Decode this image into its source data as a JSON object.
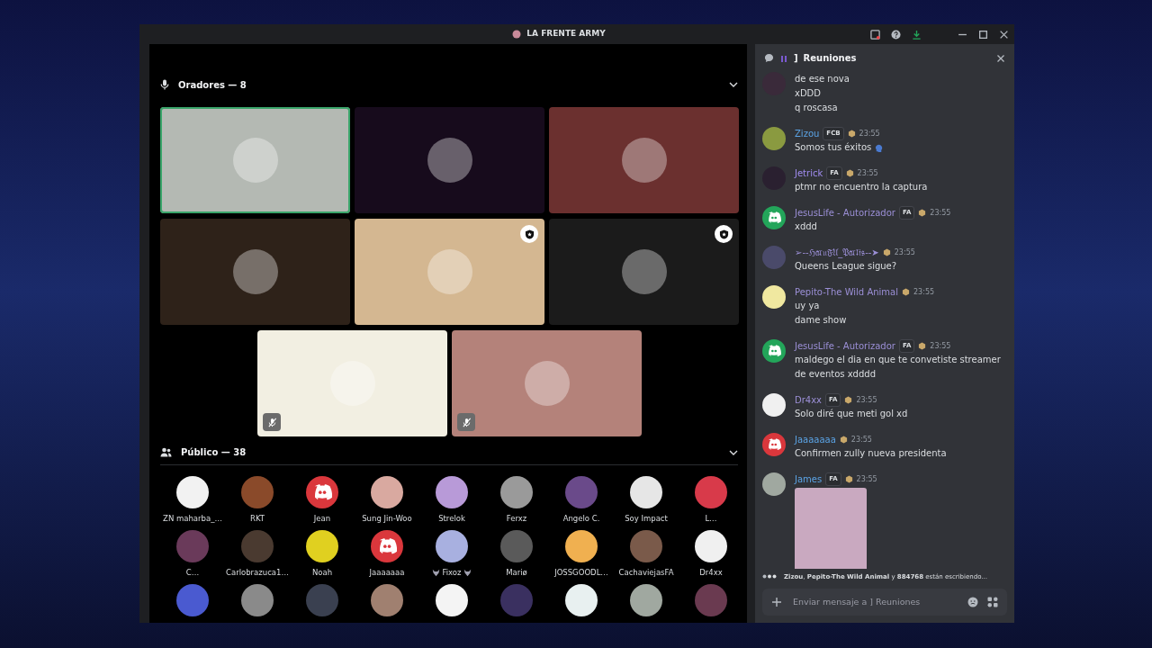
{
  "window": {
    "title": "LA FRENTE ARMY"
  },
  "stage": {
    "speakers_header": "Oradores — 8",
    "speakers": [
      {
        "color": "#b4b9b3",
        "speaking": true,
        "moderator": false,
        "muted": false
      },
      {
        "color": "#170b1c",
        "speaking": false,
        "moderator": false,
        "muted": false
      },
      {
        "color": "#6b302f",
        "speaking": false,
        "moderator": false,
        "muted": false
      },
      {
        "color": "#2e2219",
        "speaking": false,
        "moderator": false,
        "muted": false
      },
      {
        "color": "#d4b791",
        "speaking": false,
        "moderator": true,
        "muted": false
      },
      {
        "color": "#1b1b1b",
        "speaking": false,
        "moderator": true,
        "muted": false
      },
      {
        "color": "#f2efe2",
        "speaking": false,
        "moderator": false,
        "muted": true
      },
      {
        "color": "#b4827a",
        "speaking": false,
        "moderator": false,
        "muted": true
      }
    ],
    "audience_header": "Público — 38",
    "audience": [
      {
        "name": "ZN maharba_…",
        "avatar": {
          "kind": "photo",
          "color": "#f2f2f2"
        }
      },
      {
        "name": "RKT",
        "avatar": {
          "kind": "photo",
          "color": "#8a4a2a"
        }
      },
      {
        "name": "Jean",
        "avatar": {
          "kind": "default",
          "color": "#da373c"
        }
      },
      {
        "name": "Sung Jin-Woo",
        "avatar": {
          "kind": "photo",
          "color": "#d9a9a0"
        }
      },
      {
        "name": "Strelok",
        "avatar": {
          "kind": "photo",
          "color": "#b89ad8"
        }
      },
      {
        "name": "Ferxz",
        "avatar": {
          "kind": "photo",
          "color": "#9a9a9a"
        }
      },
      {
        "name": "Angelo C.",
        "avatar": {
          "kind": "photo",
          "color": "#6a4a8a"
        }
      },
      {
        "name": "Soy Impact",
        "avatar": {
          "kind": "photo",
          "color": "#e6e6e6"
        }
      },
      {
        "name": "L…",
        "avatar": {
          "kind": "photo",
          "color": "#d83a4a"
        }
      },
      {
        "name": "C…",
        "avatar": {
          "kind": "photo",
          "color": "#6a3a5a"
        }
      },
      {
        "name": "Carlobrazuca1…",
        "avatar": {
          "kind": "photo",
          "color": "#4a3a30"
        }
      },
      {
        "name": "Noah",
        "avatar": {
          "kind": "photo",
          "color": "#e0d020"
        }
      },
      {
        "name": "Jaaaaaaa",
        "avatar": {
          "kind": "default",
          "color": "#da373c"
        }
      },
      {
        "name": "Fixoz",
        "avatar": {
          "kind": "photo",
          "color": "#a8b0e0"
        },
        "emoji": true
      },
      {
        "name": "Mariø",
        "avatar": {
          "kind": "photo",
          "color": "#5a5a5a"
        }
      },
      {
        "name": "JOSSGOODL…",
        "avatar": {
          "kind": "photo",
          "color": "#f0b050"
        }
      },
      {
        "name": "CachaviejasFA",
        "avatar": {
          "kind": "photo",
          "color": "#7a5a4a"
        }
      },
      {
        "name": "Dr4xx",
        "avatar": {
          "kind": "photo",
          "color": "#f0f0f0"
        }
      },
      {
        "avatar": {
          "kind": "photo",
          "color": "#4a5ad0"
        }
      },
      {
        "avatar": {
          "kind": "photo",
          "color": "#8a8a8a"
        }
      },
      {
        "avatar": {
          "kind": "photo",
          "color": "#3a4050"
        }
      },
      {
        "avatar": {
          "kind": "photo",
          "color": "#a08070"
        }
      },
      {
        "avatar": {
          "kind": "photo",
          "color": "#f4f4f4"
        }
      },
      {
        "avatar": {
          "kind": "photo",
          "color": "#3a3060"
        }
      },
      {
        "avatar": {
          "kind": "photo",
          "color": "#e8f0f0"
        }
      },
      {
        "avatar": {
          "kind": "photo",
          "color": "#a0a8a0"
        }
      },
      {
        "avatar": {
          "kind": "photo",
          "color": "#6a3a50"
        }
      }
    ]
  },
  "chat": {
    "channel_prefix": "]",
    "title": "Reuniones",
    "messages": [
      {
        "avatar": {
          "kind": "photo",
          "color": "#3a2a3a"
        },
        "lines": [
          "de ese nova",
          "xDDD",
          "q roscasa"
        ]
      },
      {
        "author": "Zizou",
        "color": "#5ba4e6",
        "tag": "FCB",
        "time": "23:55",
        "avatar": {
          "kind": "photo",
          "color": "#8a9a40"
        },
        "lines": [
          "Somos tus éxitos"
        ],
        "emoji": true
      },
      {
        "author": "Jetrick",
        "color": "#a08cf0",
        "tag": "FA",
        "time": "23:55",
        "avatar": {
          "kind": "photo",
          "color": "#2a2030"
        },
        "lines": [
          "ptmr no encuentro la captura"
        ]
      },
      {
        "author": "JesusLife - Autorizador",
        "color": "#9b8fd6",
        "tag": "FA",
        "time": "23:55",
        "avatar": {
          "kind": "default",
          "color": "#23a55a"
        },
        "lines": [
          "xddd"
        ]
      },
      {
        "author": "➢--ℌ𝔞𝔯𝔲𝔉𝔘_𝔓𝔞𝔯𝔩𝔦𝔰--➤",
        "color": "#9b8fd6",
        "time": "23:55",
        "avatar": {
          "kind": "photo",
          "color": "#4a4a6a"
        },
        "lines": [
          "Queens League sigue?"
        ]
      },
      {
        "author": "Pepito-The Wild Animal",
        "color": "#9b8fd6",
        "time": "23:55",
        "avatar": {
          "kind": "photo",
          "color": "#f0e8a0"
        },
        "lines": [
          "uy ya",
          "dame show"
        ]
      },
      {
        "author": "JesusLife - Autorizador",
        "color": "#9b8fd6",
        "tag": "FA",
        "time": "23:55",
        "avatar": {
          "kind": "default",
          "color": "#23a55a"
        },
        "lines": [
          "maldego el dia en que te convetiste streamer de eventos xdddd"
        ]
      },
      {
        "author": "Dr4xx",
        "color": "#9b8fd6",
        "tag": "FA",
        "time": "23:55",
        "avatar": {
          "kind": "photo",
          "color": "#f0f0f0"
        },
        "lines": [
          "Solo diré que meti gol xd"
        ]
      },
      {
        "author": "Jaaaaaaa",
        "color": "#5ba4e6",
        "time": "23:55",
        "avatar": {
          "kind": "default",
          "color": "#da373c"
        },
        "lines": [
          "Confirmen zully nueva presidenta"
        ]
      },
      {
        "author": "James",
        "color": "#5ba4e6",
        "tag": "FA",
        "time": "23:55",
        "avatar": {
          "kind": "photo",
          "color": "#a0a8a0"
        },
        "image": true
      }
    ],
    "typing": "**Zizou**, **Pepito-The Wild Animal** y **884768** están escribiendo...",
    "input": {
      "placeholder": "Enviar mensaje a ] Reuniones"
    }
  }
}
